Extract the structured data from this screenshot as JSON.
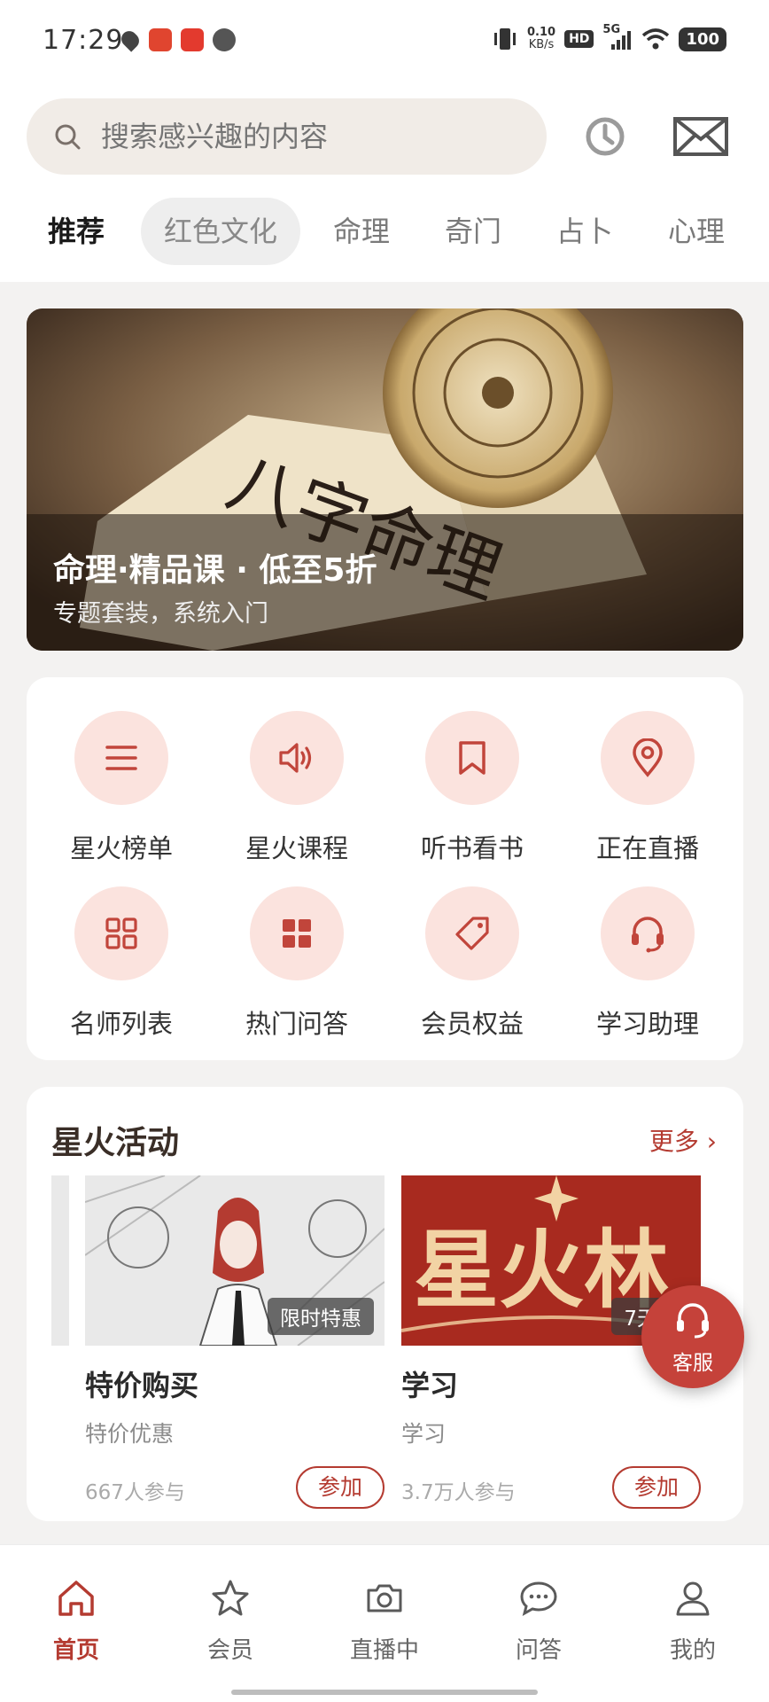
{
  "status_bar": {
    "time": "17:29",
    "net_speed": "0.10",
    "net_unit": "KB/s",
    "hd": "HD",
    "signal": "5G",
    "battery": "100"
  },
  "search": {
    "placeholder": "搜索感兴趣的内容",
    "value": ""
  },
  "tabs": [
    {
      "label": "推荐",
      "state": "active"
    },
    {
      "label": "红色文化",
      "state": "pill"
    },
    {
      "label": "命理"
    },
    {
      "label": "奇门"
    },
    {
      "label": "占卜"
    },
    {
      "label": "心理"
    }
  ],
  "banner": {
    "title": "命理·精品课 · 低至5折",
    "subtitle": "专题套装，系统入门",
    "art_text": "八字命理"
  },
  "grid": [
    {
      "label": "星火榜单",
      "icon": "list-icon"
    },
    {
      "label": "星火课程",
      "icon": "speaker-icon"
    },
    {
      "label": "听书看书",
      "icon": "bookmark-icon"
    },
    {
      "label": "正在直播",
      "icon": "location-pin-icon"
    },
    {
      "label": "名师列表",
      "icon": "grid-outline-icon"
    },
    {
      "label": "热门问答",
      "icon": "grid-filled-icon"
    },
    {
      "label": "会员权益",
      "icon": "tag-icon"
    },
    {
      "label": "学习助理",
      "icon": "headset-icon"
    }
  ],
  "activities": {
    "title": "星火活动",
    "more": "更多 ›",
    "items": [
      {
        "name": "特价购买",
        "desc": "特价优惠",
        "count": "667人参与",
        "tag": "限时特惠",
        "action": "参加"
      },
      {
        "name": "学习",
        "desc": "学习",
        "count": "3.7万人参与",
        "tag": "7天打",
        "action": "参加",
        "image_text": "星火林"
      }
    ]
  },
  "float_service": {
    "label": "客服"
  },
  "bottom_nav": [
    {
      "label": "首页",
      "icon": "home-icon",
      "active": true
    },
    {
      "label": "会员",
      "icon": "star-icon"
    },
    {
      "label": "直播中",
      "icon": "camera-icon"
    },
    {
      "label": "问答",
      "icon": "chat-icon"
    },
    {
      "label": "我的",
      "icon": "user-icon"
    }
  ],
  "colors": {
    "accent": "#b43b31",
    "icon_bg": "#fbe3de",
    "page_bg": "#f3f2f1"
  }
}
